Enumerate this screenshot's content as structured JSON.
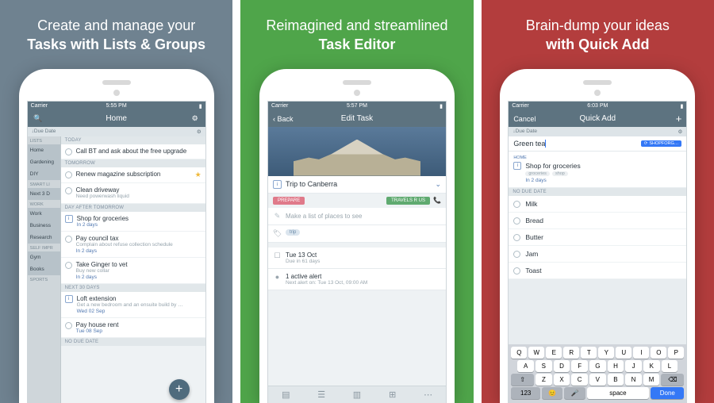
{
  "panels": [
    {
      "headline_pre": "Create and manage your",
      "headline_main": "Tasks with Lists & Groups"
    },
    {
      "headline_pre": "Reimagined and streamlined",
      "headline_main": "Task Editor"
    },
    {
      "headline_pre": "Brain-dump your ideas",
      "headline_main": "with Quick Add"
    }
  ],
  "screen1": {
    "status": {
      "carrier": "Carrier",
      "time": "5:55 PM"
    },
    "nav": {
      "title": "Home"
    },
    "subhead_left": "↓Due Date",
    "sidebar": {
      "sections": [
        {
          "label": "LISTS",
          "items": [
            {
              "label": "Home",
              "cls": "sb-home"
            },
            {
              "label": "Gardening",
              "cls": "sb-gardening"
            },
            {
              "label": "DIY",
              "cls": "sb-diy"
            }
          ]
        },
        {
          "label": "SMART LI",
          "items": [
            {
              "label": "Next 3 D",
              "cls": "sb-next3"
            }
          ]
        },
        {
          "label": "WORK",
          "items": [
            {
              "label": "Work",
              "cls": "sb-work"
            },
            {
              "label": "Business",
              "cls": "sb-biz"
            },
            {
              "label": "Research",
              "cls": "sb-research"
            }
          ]
        },
        {
          "label": "SELF IMPR",
          "items": [
            {
              "label": "Gym",
              "cls": "sb-gym"
            },
            {
              "label": "Books",
              "cls": "sb-books"
            }
          ]
        },
        {
          "label": "SPORTS",
          "items": []
        }
      ]
    },
    "groups": [
      {
        "label": "TODAY",
        "tasks": [
          {
            "title": "Call BT and ask about the free upgrade"
          }
        ]
      },
      {
        "label": "TOMORROW",
        "tasks": [
          {
            "title": "Renew magazine subscription",
            "star": true
          },
          {
            "title": "Clean driveway",
            "sub": "Need powerwash liquid"
          }
        ]
      },
      {
        "label": "DAY AFTER TOMORROW",
        "tasks": [
          {
            "title": "Shop for groceries",
            "due": "In 2 days",
            "sq": "i"
          },
          {
            "title": "Pay council tax",
            "sub": "Complain about refuse collection schedule",
            "due": "In 2 days"
          },
          {
            "title": "Take Ginger to vet",
            "sub": "Buy new collar",
            "due": "In 2 days"
          }
        ]
      },
      {
        "label": "NEXT 30 DAYS",
        "tasks": [
          {
            "title": "Loft extension",
            "sub": "Get a new bedroom and an ensuite build by …",
            "due": "Wed 02 Sep",
            "sq": "i"
          },
          {
            "title": "Pay house rent",
            "due": "Tue 08 Sep"
          }
        ]
      },
      {
        "label": "NO DUE DATE",
        "tasks": []
      }
    ]
  },
  "screen2": {
    "status": {
      "carrier": "Carrier",
      "time": "5:57 PM"
    },
    "nav": {
      "back": "Back",
      "title": "Edit Task"
    },
    "task_title": "Trip to Canberra",
    "pills": [
      {
        "label": "PREPARE",
        "cls": "pink"
      },
      {
        "label": "TRAVELS R US",
        "cls": "green"
      }
    ],
    "note": "Make a list of places to see",
    "tag": "trip",
    "date_line1": "Tue 13 Oct",
    "date_line2": "Due in 61 days",
    "alert_line1": "1 active alert",
    "alert_line2": "Next alert on: Tue 13 Oct, 09:00 AM"
  },
  "screen3": {
    "status": {
      "carrier": "Carrier",
      "time": "6:03 PM"
    },
    "nav": {
      "cancel": "Cancel",
      "title": "Quick Add",
      "plus": "+"
    },
    "subhead_left": "↓Due Date",
    "input_value": "Green tea",
    "shop_badge": "SHOPFORG…",
    "preview": {
      "category": "HOME",
      "title": "Shop for groceries",
      "chips": [
        "groceries",
        "shop"
      ],
      "due": "In 2 days"
    },
    "nodate_label": "NO DUE DATE",
    "items": [
      "Milk",
      "Bread",
      "Butter",
      "Jam",
      "Toast"
    ],
    "keyboard": {
      "row1": [
        "Q",
        "W",
        "E",
        "R",
        "T",
        "Y",
        "U",
        "I",
        "O",
        "P"
      ],
      "row2": [
        "A",
        "S",
        "D",
        "F",
        "G",
        "H",
        "J",
        "K",
        "L"
      ],
      "row3": [
        "Z",
        "X",
        "C",
        "V",
        "B",
        "N",
        "M"
      ],
      "shift": "⇧",
      "del": "⌫",
      "num": "123",
      "emoji": "😊",
      "mic": "🎤",
      "space": "space",
      "done": "Done"
    }
  }
}
